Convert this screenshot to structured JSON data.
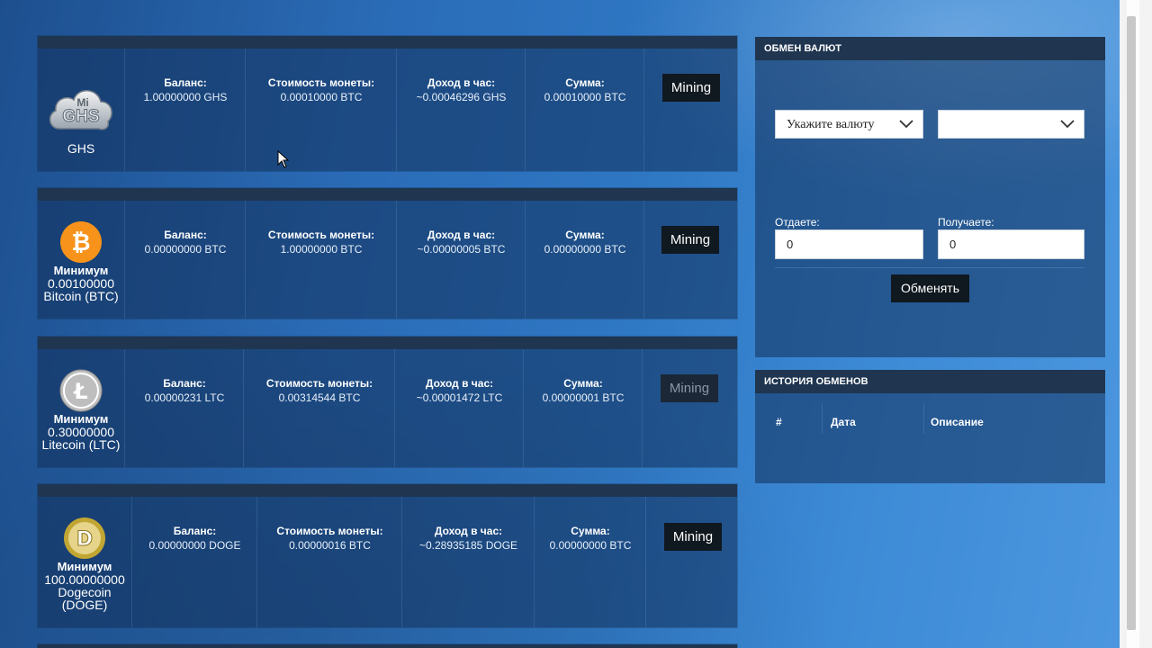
{
  "coins": [
    {
      "icon": "ghs-cloud-icon",
      "icon_text": "Mi GHS",
      "caption_line1": "",
      "caption_line2": "GHS",
      "caption_line3": "",
      "caption_line4": "",
      "balance_label": "Баланс:",
      "balance": "1.00000000 GHS",
      "price_label": "Стоимость монеты:",
      "price": "0.00010000 BTC",
      "income_label": "Доход в час:",
      "income": "~0.00046296 GHS",
      "sum_label": "Сумма:",
      "sum": "0.00010000 BTC",
      "button": "Mining",
      "button_disabled": false
    },
    {
      "icon": "bitcoin-icon",
      "icon_text": "₿",
      "caption_line1": "Минимум",
      "caption_line2": "0.00100000",
      "caption_line3": "Bitcoin (BTC)",
      "caption_line4": "",
      "balance_label": "Баланс:",
      "balance": "0.00000000 BTC",
      "price_label": "Стоимость монеты:",
      "price": "1.00000000 BTC",
      "income_label": "Доход в час:",
      "income": "~0.00000005 BTC",
      "sum_label": "Сумма:",
      "sum": "0.00000000 BTC",
      "button": "Mining",
      "button_disabled": false
    },
    {
      "icon": "litecoin-icon",
      "icon_text": "Ł",
      "caption_line1": "Минимум",
      "caption_line2": "0.30000000",
      "caption_line3": "Litecoin (LTC)",
      "caption_line4": "",
      "balance_label": "Баланс:",
      "balance": "0.00000231 LTC",
      "price_label": "Стоимость монеты:",
      "price": "0.00314544 BTC",
      "income_label": "Доход в час:",
      "income": "~0.00001472 LTC",
      "sum_label": "Сумма:",
      "sum": "0.00000001 BTC",
      "button": "Mining",
      "button_disabled": true
    },
    {
      "icon": "dogecoin-icon",
      "icon_text": "D",
      "caption_line1": "Минимум",
      "caption_line2": "100.00000000",
      "caption_line3": "Dogecoin",
      "caption_line4": "(DOGE)",
      "balance_label": "Баланс:",
      "balance": "0.00000000 DOGE",
      "price_label": "Стоимость монеты:",
      "price": "0.00000016 BTC",
      "income_label": "Доход в час:",
      "income": "~0.28935185 DOGE",
      "sum_label": "Сумма:",
      "sum": "0.00000000 BTC",
      "button": "Mining",
      "button_disabled": false
    }
  ],
  "exchange": {
    "title": "ОБМЕН ВАЛЮТ",
    "from_select": "Укажите валюту",
    "to_select": "",
    "give_label": "Отдаете:",
    "give_value": "0",
    "get_label": "Получаете:",
    "get_value": "0",
    "button": "Обменять"
  },
  "history": {
    "title": "ИСТОРИЯ ОБМЕНОВ",
    "col_num": "#",
    "col_date": "Дата",
    "col_desc": "Описание"
  },
  "colors": {
    "accent_dark": "#101820",
    "bitcoin": "#f7931a",
    "dogecoin": "#c2a633",
    "litecoin": "#bebebe"
  }
}
